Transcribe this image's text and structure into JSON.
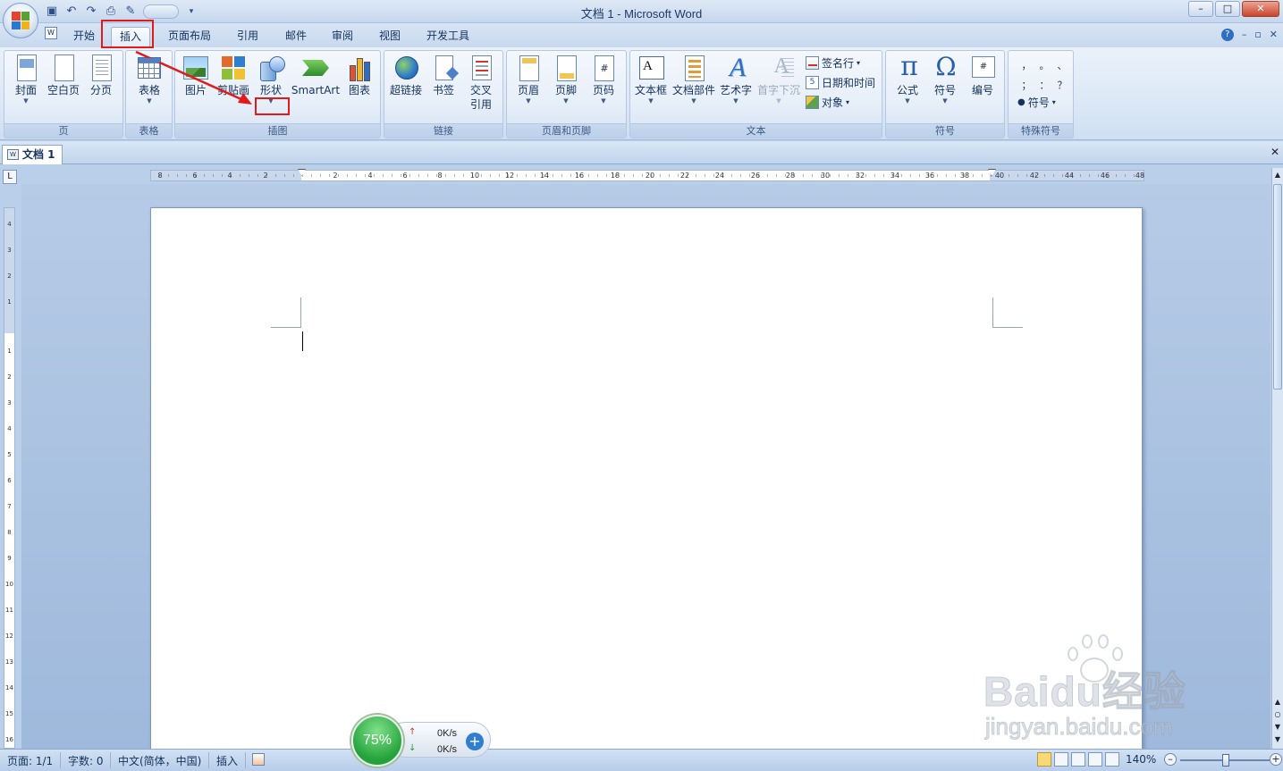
{
  "window": {
    "title": "文档 1 - Microsoft Word",
    "controls": [
      "–",
      "□",
      "✕"
    ]
  },
  "tabs": [
    {
      "label": "开始",
      "active": false
    },
    {
      "label": "插入",
      "active": true
    },
    {
      "label": "页面布局",
      "active": false
    },
    {
      "label": "引用",
      "active": false
    },
    {
      "label": "邮件",
      "active": false
    },
    {
      "label": "审阅",
      "active": false
    },
    {
      "label": "视图",
      "active": false
    },
    {
      "label": "开发工具",
      "active": false
    }
  ],
  "ribbon": {
    "groups": {
      "page": {
        "label": "页",
        "cover": "封面",
        "blank": "空白页",
        "pagebreak": "分页"
      },
      "table": {
        "label": "表格",
        "table": "表格"
      },
      "illustrations": {
        "label": "插图",
        "picture": "图片",
        "clipart": "剪贴画",
        "shapes": "形状",
        "smartart": "SmartArt",
        "chart": "图表"
      },
      "links": {
        "label": "链接",
        "hyperlink": "超链接",
        "bookmark": "书签",
        "crossref_line1": "交叉",
        "crossref_line2": "引用"
      },
      "headerfooter": {
        "label": "页眉和页脚",
        "header": "页眉",
        "footer": "页脚",
        "pagenumber": "页码"
      },
      "text": {
        "label": "文本",
        "textbox": "文本框",
        "quickparts": "文档部件",
        "wordart": "艺术字",
        "dropcap": "首字下沉",
        "signature": "签名行",
        "datetime": "日期和时间",
        "object": "对象"
      },
      "symbols": {
        "label": "符号",
        "equation": "公式",
        "symbol": "符号",
        "numbering": "编号"
      },
      "special": {
        "label": "特殊符号",
        "chars": [
          "，",
          "。",
          "、",
          "；",
          "：",
          "？"
        ],
        "symbol": "符号"
      }
    }
  },
  "document": {
    "tab_label": "文档 1"
  },
  "ruler": {
    "h_labels": [
      "8",
      "6",
      "4",
      "2",
      "2",
      "4",
      "6",
      "8",
      "10",
      "12",
      "14",
      "16",
      "18",
      "20",
      "22",
      "24",
      "26",
      "28",
      "30",
      "32",
      "34",
      "36",
      "38",
      "40",
      "42",
      "44",
      "46",
      "48"
    ],
    "v_labels": [
      "4",
      "3",
      "2",
      "1",
      "1",
      "2",
      "3",
      "4",
      "5",
      "6",
      "7",
      "8",
      "9",
      "10",
      "11",
      "12",
      "13",
      "14",
      "15",
      "16"
    ]
  },
  "statusbar": {
    "page": "页面: 1/1",
    "words": "字数: 0",
    "language": "中文(简体，中国)",
    "mode": "插入",
    "zoom": "140%"
  },
  "net_widget": {
    "percent": "75%",
    "up": "0K/s",
    "down": "0K/s"
  },
  "watermark": {
    "brand": "Baidu经验",
    "url": "jingyan.baidu.com"
  },
  "colors": {
    "annotation": "#e21a1a",
    "ribbon_bg": "#dde8f6",
    "workspace": "#a9c1e0"
  }
}
